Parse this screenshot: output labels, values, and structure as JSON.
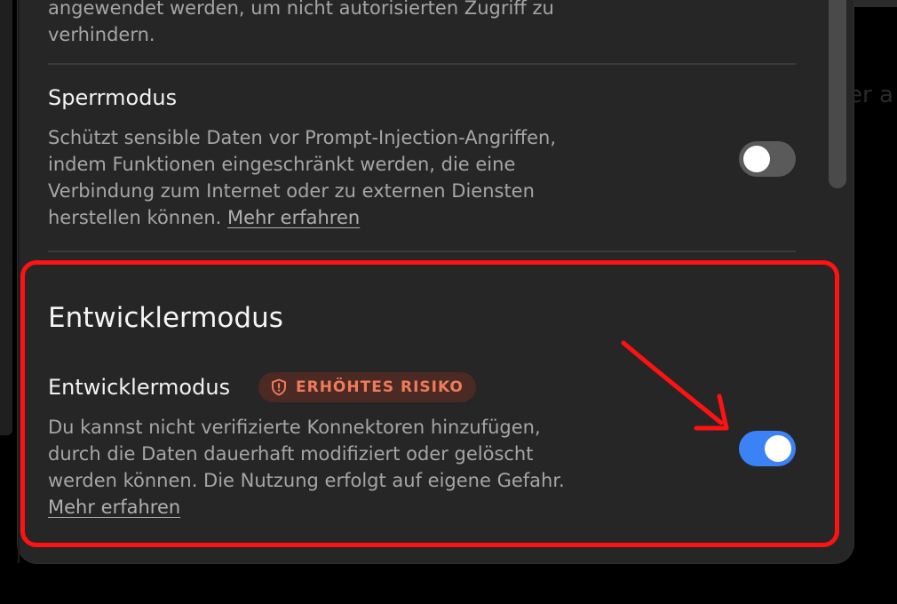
{
  "background": {
    "ghost_text": "er a"
  },
  "previous_setting": {
    "description_partial": "angewendet werden, um nicht autorisierten Zugriff zu verhindern."
  },
  "lock_mode": {
    "title": "Sperrmodus",
    "description": "Schützt sensible Daten vor Prompt-Injection-Angriffen, indem Funktionen eingeschränkt werden, die eine Verbindung zum Internet oder zu externen Diensten herstellen können. ",
    "learn_more": "Mehr erfahren",
    "toggle_state": "off"
  },
  "developer_section": {
    "heading": "Entwicklermodus",
    "setting_title": "Entwicklermodus",
    "badge_label": "ERHÖHTES RISIKO",
    "badge_icon": "shield-alert-icon",
    "description": "Du kannst nicht verifizierte Konnektoren hinzufügen, durch die Daten dauerhaft modifiziert oder gelöscht werden können. Die Nutzung erfolgt auf eigene Gefahr. ",
    "learn_more": "Mehr erfahren",
    "toggle_state": "on"
  },
  "colors": {
    "panel": "#262626",
    "toggle_on": "#3b82f6",
    "toggle_off": "#5a5a5a",
    "badge_bg": "#4a2a22",
    "badge_text": "#f07a5c",
    "annotation": "#ff1212"
  }
}
